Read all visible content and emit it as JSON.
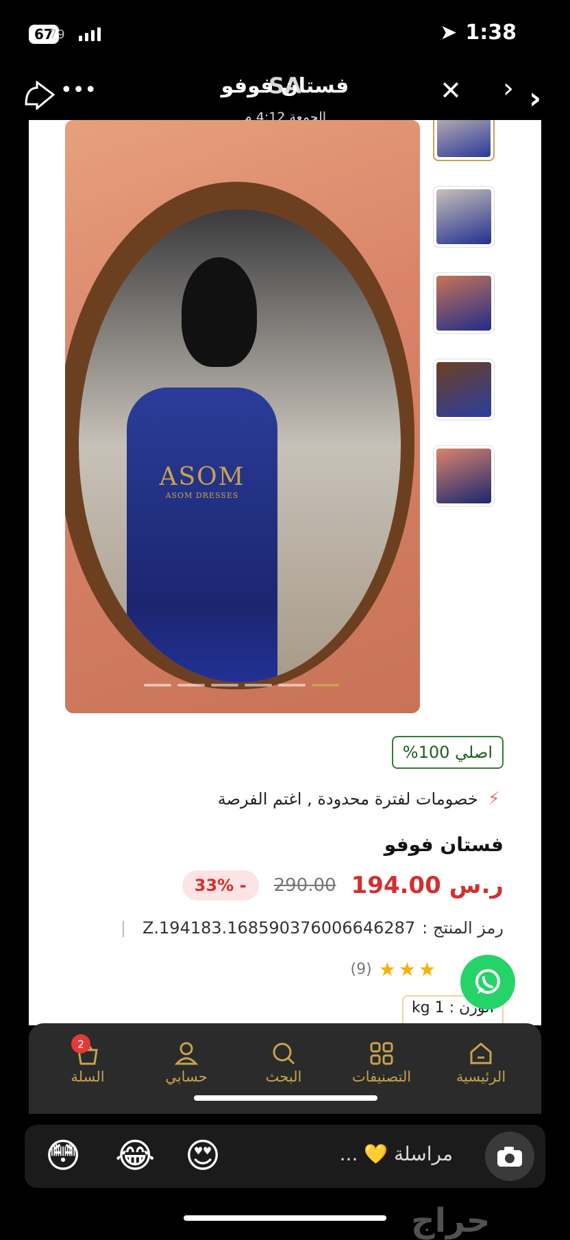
{
  "status": {
    "time": "1:38",
    "battery": "67",
    "battery_overlay": "79"
  },
  "header": {
    "title": "فستان فوفو",
    "title_overlay": "SA",
    "subtitle": "الجمعة 4:12 م"
  },
  "product": {
    "watermark_brand": "ASOM",
    "watermark_sub": "ASOM DRESSES",
    "image_count": 6,
    "active_image": 6,
    "original_badge": "اصلي 100%",
    "promo_text": "خصومات لفترة محدودة , اغتم الفرصة",
    "name": "فستان فوفو",
    "price": "194.00",
    "old_price": "290.00",
    "currency_symbol": "ر.س",
    "discount": "- 33%",
    "code_label": "رمز المنتج :",
    "code_value": "Z.194183.168590376006646287",
    "rating_stars": 3,
    "rating_count": "(9)",
    "weight": "الوزن : kg 1"
  },
  "nav": {
    "home": "الرئيسية",
    "categories": "التصنيفات",
    "search": "البحث",
    "account": "حسابي",
    "cart": "السلة",
    "cart_count": "2"
  },
  "reply": {
    "placeholder": "مراسلة 💛 ...",
    "emoji1": "😳",
    "emoji2": "😂",
    "emoji3": "😍"
  },
  "brand_watermark": "حراج",
  "colors": {
    "accent": "#c9a24d",
    "price": "#d32f2f",
    "whatsapp": "#25d366",
    "original_green": "#2e7d32"
  }
}
